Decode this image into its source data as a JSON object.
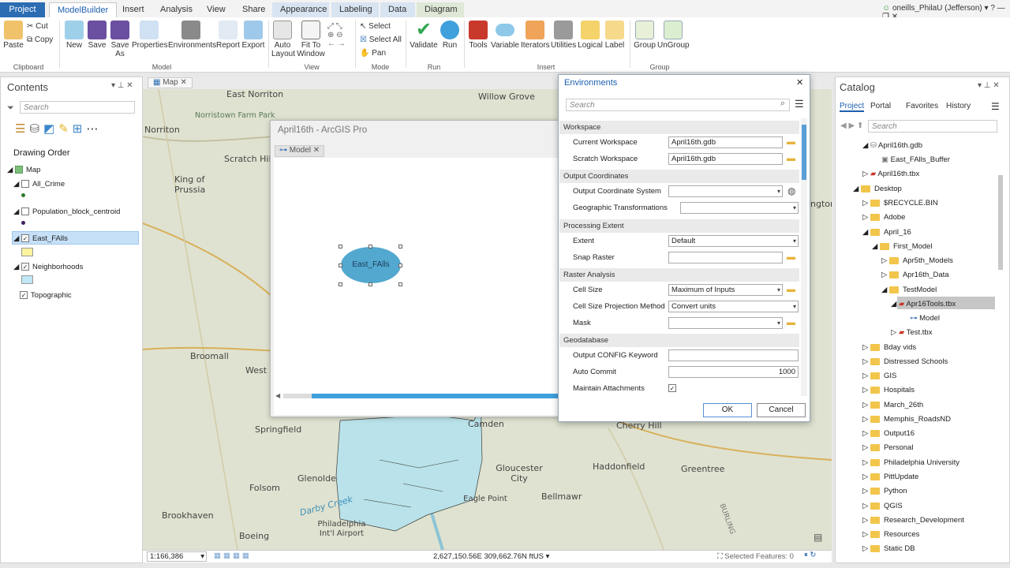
{
  "tabs": [
    "Project",
    "ModelBuilder",
    "Insert",
    "Analysis",
    "View",
    "Share",
    "Appearance",
    "Labeling",
    "Data",
    "Diagram"
  ],
  "user": "oneills_PhilaU (Jefferson)",
  "ribbon": {
    "clipboard": {
      "paste": "Paste",
      "cut": "Cut",
      "copy": "Copy",
      "group": "Clipboard"
    },
    "model": {
      "new": "New",
      "save": "Save",
      "save_as": "Save As",
      "properties": "Properties",
      "environments": "Environments",
      "report": "Report",
      "export": "Export",
      "group": "Model"
    },
    "view": {
      "auto_layout": "Auto Layout",
      "fit": "Fit To Window",
      "group": "View"
    },
    "mode": {
      "select": "Select",
      "select_all": "Select All",
      "pan": "Pan",
      "group": "Mode"
    },
    "run": {
      "validate": "Validate",
      "run": "Run",
      "group": "Run"
    },
    "insert": {
      "tools": "Tools",
      "variable": "Variable",
      "iterators": "Iterators",
      "utilities": "Utilities",
      "logical": "Logical",
      "label": "Label",
      "group": "Insert"
    },
    "groupg": {
      "group": "Group",
      "ungroup": "UnGroup",
      "gname": "Group"
    }
  },
  "contents": {
    "title": "Contents",
    "search": "Search",
    "drawing_order": "Drawing Order",
    "layers": [
      "Map",
      "All_Crime",
      "Population_block_centroid",
      "East_FAlls",
      "Neighborhoods",
      "Topographic"
    ]
  },
  "map_tab": "Map",
  "model_window": {
    "title": "April16th - ArcGIS Pro",
    "tab": "Model",
    "node": "East_FAlls"
  },
  "env": {
    "title": "Environments",
    "search": "Search",
    "sections": [
      "Workspace",
      "Output Coordinates",
      "Processing Extent",
      "Raster Analysis",
      "Geodatabase"
    ],
    "rows": {
      "current_ws": "Current Workspace",
      "scratch_ws": "Scratch Workspace",
      "ocs": "Output Coordinate System",
      "geo": "Geographic Transformations",
      "extent": "Extent",
      "snap": "Snap Raster",
      "cell": "Cell Size",
      "cellproj": "Cell Size Projection Method",
      "mask": "Mask",
      "config": "Output CONFIG Keyword",
      "commit": "Auto Commit",
      "attach": "Maintain Attachments"
    },
    "values": {
      "current_ws": "April16th.gdb",
      "scratch_ws": "April16th.gdb",
      "extent": "Default",
      "cell": "Maximum of Inputs",
      "cellproj": "Convert units",
      "commit": "1000"
    },
    "ok": "OK",
    "cancel": "Cancel"
  },
  "catalog": {
    "title": "Catalog",
    "tabs": [
      "Project",
      "Portal",
      "Favorites",
      "History"
    ],
    "search": "Search",
    "items": [
      "April16th.gdb",
      "East_FAlls_Buffer",
      "April16th.tbx",
      "Desktop",
      "$RECYCLE.BIN",
      "Adobe",
      "April_16",
      "First_Model",
      "Apr5th_Models",
      "Apr16th_Data",
      "TestModel",
      "Apr16Tools.tbx",
      "Model",
      "Test.tbx",
      "Bday vids",
      "Distressed Schools",
      "GIS",
      "Hospitals",
      "March_26th",
      "Memphis_RoadsND",
      "Output16",
      "Personal",
      "Philadelphia University",
      "PittUpdate",
      "Python",
      "QGIS",
      "Research_Development",
      "Resources",
      "Static DB"
    ]
  },
  "map_labels": [
    "East Norriton",
    "Norristown Farm Park",
    "Norriton",
    "King of Prussia",
    "Scratch Hill",
    "Willow Grove",
    "Broomall",
    "West Chester",
    "Springfield",
    "Glenolde",
    "Folsom",
    "Darby Creek",
    "Brookhaven",
    "Philadelphia Int'l Airport",
    "Boeing",
    "Gloucester City",
    "Haddonfield",
    "Cherry Hill",
    "Greentree",
    "Camden",
    "Eagle Point",
    "Bellmawr",
    "ngton",
    "BURLING"
  ],
  "status": {
    "scale": "1:166,386",
    "coords": "2,627,150.56E 309,662.76N ftUS",
    "selected": "Selected Features: 0"
  }
}
